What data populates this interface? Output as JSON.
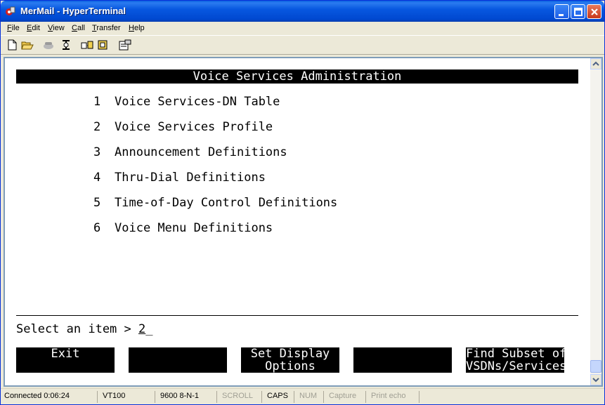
{
  "window": {
    "title": "MerMail - HyperTerminal"
  },
  "menubar": [
    "File",
    "Edit",
    "View",
    "Call",
    "Transfer",
    "Help"
  ],
  "toolbar": [
    "new-icon",
    "open-icon",
    "call-icon",
    "disconnect-icon",
    "send-icon",
    "receive-icon",
    "properties-icon"
  ],
  "terminal": {
    "header": "Voice Services Administration",
    "items": [
      {
        "num": "1",
        "label": "Voice Services-DN Table"
      },
      {
        "num": "2",
        "label": "Voice Services Profile"
      },
      {
        "num": "3",
        "label": "Announcement Definitions"
      },
      {
        "num": "4",
        "label": "Thru-Dial Definitions"
      },
      {
        "num": "5",
        "label": "Time-of-Day Control Definitions"
      },
      {
        "num": "6",
        "label": "Voice Menu Definitions"
      }
    ],
    "prompt_label": "Select an item > ",
    "prompt_value": "2",
    "softkeys": [
      "Exit",
      "",
      "Set Display\nOptions",
      "",
      "Find Subset of\nVSDNs/Services"
    ]
  },
  "statusbar": {
    "connected": "Connected 0:06:24",
    "emulation": "VT100",
    "settings": "9600 8-N-1",
    "scroll": "SCROLL",
    "caps": "CAPS",
    "num": "NUM",
    "capture": "Capture",
    "print_echo": "Print echo"
  }
}
